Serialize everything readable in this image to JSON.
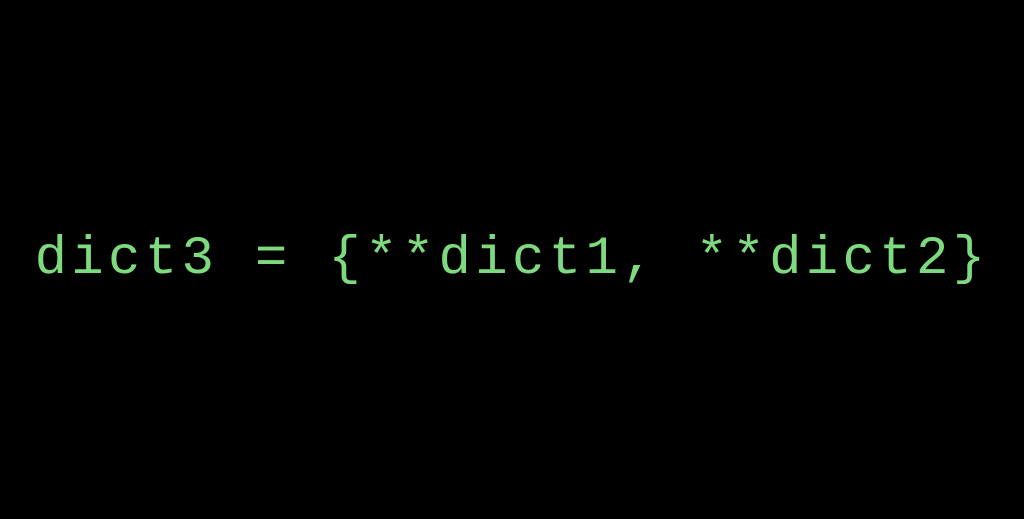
{
  "code": {
    "line": "dict3 = {**dict1, **dict2}"
  }
}
